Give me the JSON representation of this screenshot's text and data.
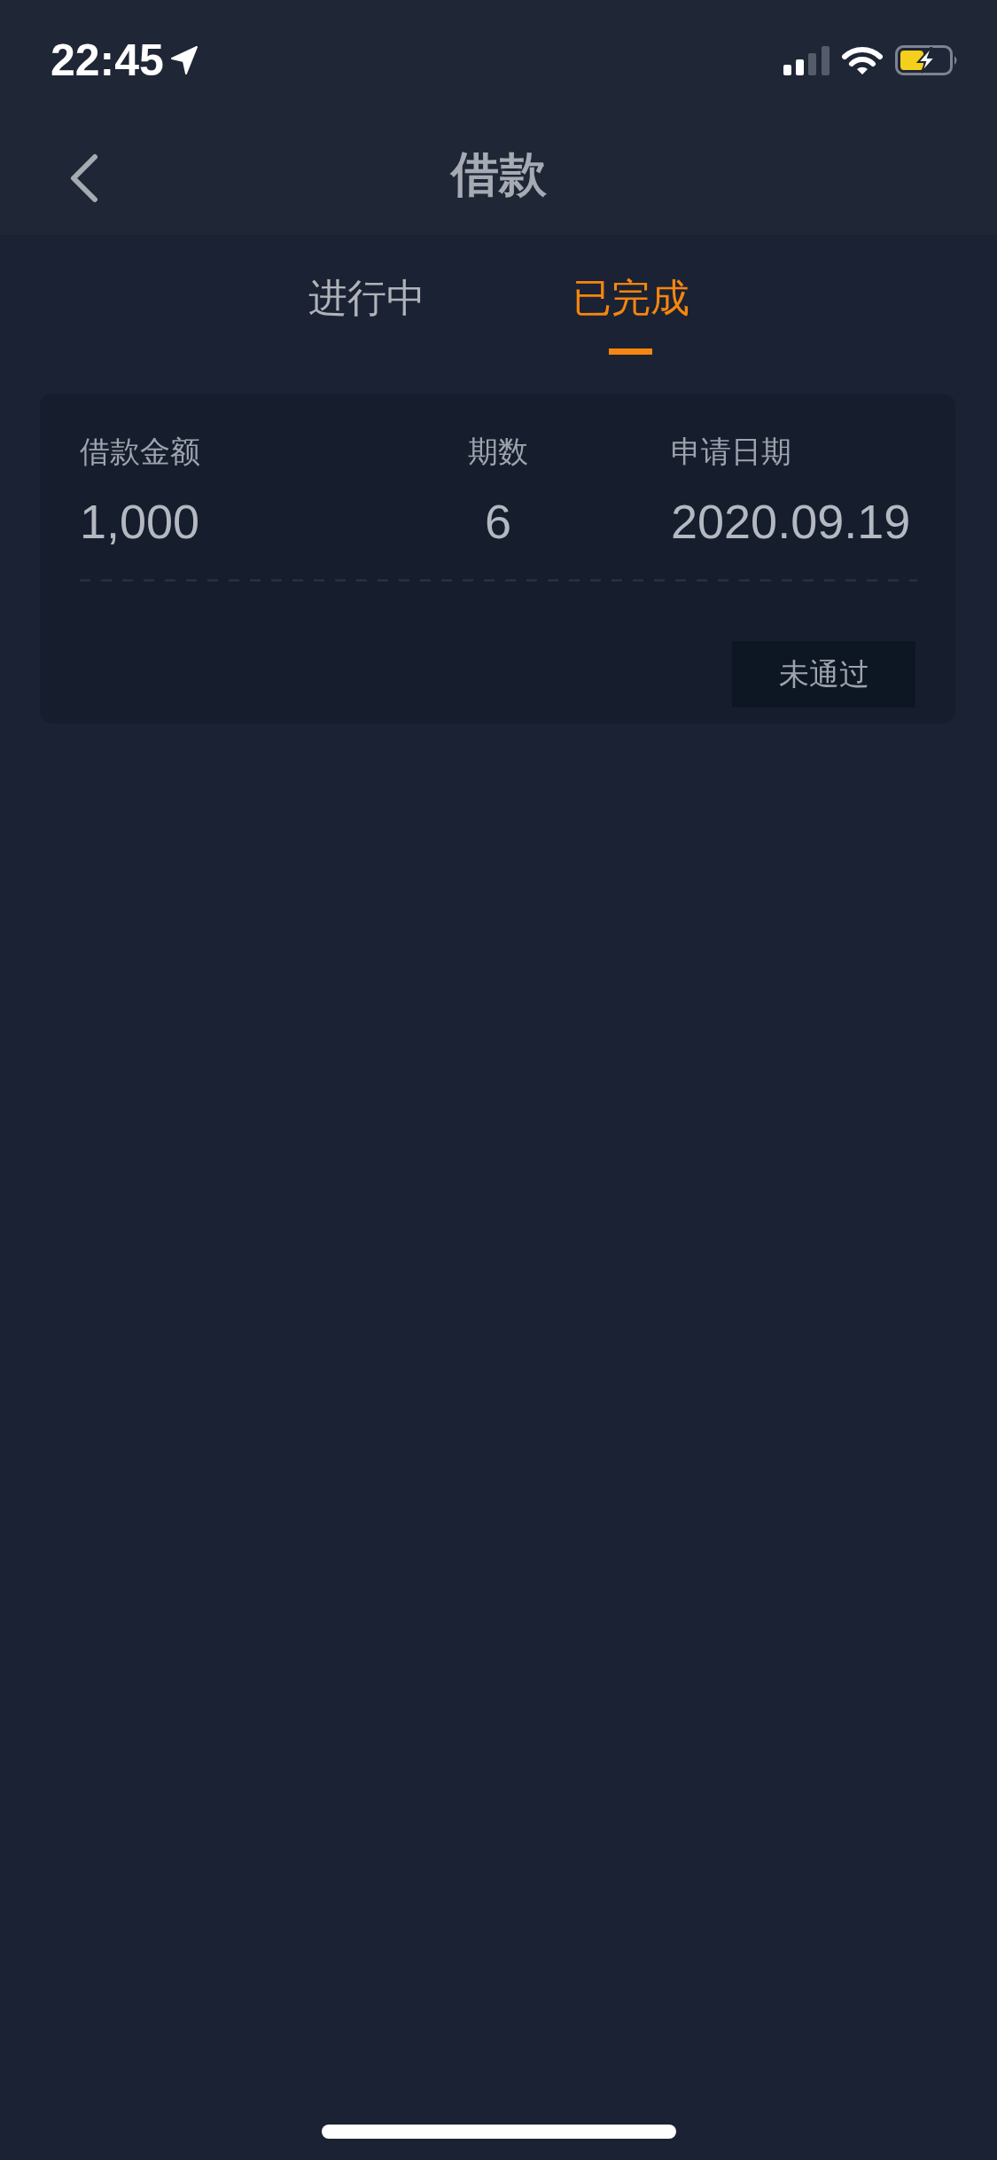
{
  "status_bar": {
    "time": "22:45"
  },
  "nav_bar": {
    "title": "借款"
  },
  "tabs": [
    {
      "label": "进行中",
      "selected": false
    },
    {
      "label": "已完成",
      "selected": true
    }
  ],
  "loans": [
    {
      "fields": [
        {
          "label": "借款金额",
          "value": "1,000"
        },
        {
          "label": "期数",
          "value": "6"
        },
        {
          "label": "申请日期",
          "value": "2020.09.19"
        }
      ],
      "status": "未通过"
    }
  ]
}
